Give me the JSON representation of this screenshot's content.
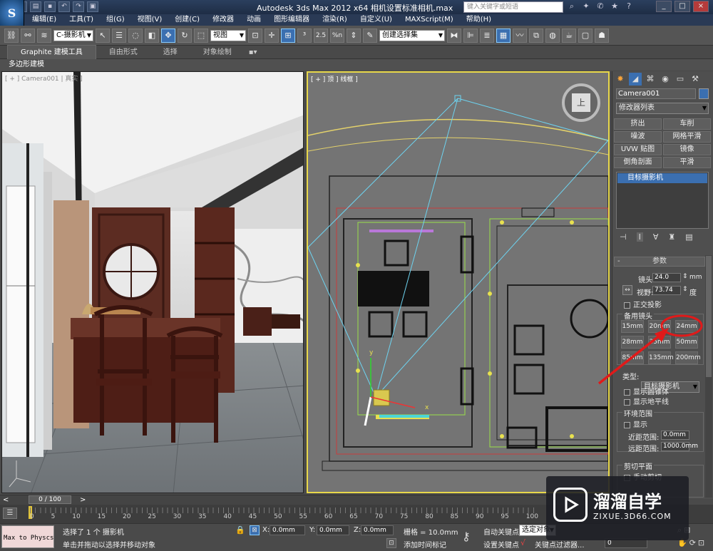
{
  "titlebar": {
    "title": "Autodesk 3ds Max  2012 x64     相机设置标准相机.max",
    "search_placeholder": "键入关键字或短语",
    "controls": [
      "_",
      "□",
      "×"
    ]
  },
  "menu": [
    "编辑(E)",
    "工具(T)",
    "组(G)",
    "视图(V)",
    "创建(C)",
    "修改器",
    "动画",
    "图形编辑器",
    "渲染(R)",
    "自定义(U)",
    "MAXScript(M)",
    "帮助(H)"
  ],
  "toolbar": {
    "filter": "C-摄影机",
    "ref_coord": "视图",
    "selection_set": "创建选择集",
    "angle_snap": "2.5",
    "percent_snap": "%n"
  },
  "ribbon": {
    "tabs": [
      "Graphite 建模工具",
      "自由形式",
      "选择",
      "对象绘制"
    ],
    "sub_label": "多边形建模"
  },
  "viewports": {
    "left_label": "[ + ] Camera001 | 真实 ]",
    "right_label": "[ + ] 顶 ] 线框 ]",
    "viewcube_label": "上"
  },
  "command_panel": {
    "object_name": "Camera001",
    "modifier_list": "修改器列表",
    "modifier_buttons": [
      "挤出",
      "车削",
      "噪波",
      "网格平滑",
      "UVW 贴图",
      "镜像",
      "倒角剖面",
      "平滑"
    ],
    "stack_item": "目标摄影机",
    "rollout_title": "参数",
    "lens_label": "镜头:",
    "lens_value": "24.0",
    "lens_unit": "mm",
    "fov_label": "视野:",
    "fov_value": "73.74",
    "fov_unit": "度",
    "ortho_label": "正交投影",
    "stock_lenses_label": "备用镜头",
    "stock_lenses": [
      "15mm",
      "20mm",
      "24mm",
      "28mm",
      "35mm",
      "50mm",
      "85mm",
      "135mm",
      "200mm"
    ],
    "type_label": "类型:",
    "type_value": "目标摄影机",
    "show_cone": "显示圆锥体",
    "show_horizon": "显示地平线",
    "env_range_label": "环境范围",
    "env_show": "显示",
    "near_range_label": "近距范围:",
    "near_range_value": "0.0mm",
    "far_range_label": "远距范围:",
    "far_range_value": "1000.0mm",
    "clip_label": "剪切平面",
    "manual_clip": "手动剪切"
  },
  "timeline": {
    "frame_display": "0 / 100",
    "ticks": [
      "0",
      "5",
      "10",
      "15",
      "20",
      "25",
      "30",
      "35",
      "40",
      "45",
      "50",
      "55",
      "60",
      "65",
      "70",
      "75",
      "80",
      "85",
      "90",
      "95",
      "100"
    ]
  },
  "statusbar": {
    "script_field": "Max to Physcs",
    "status_line1": "选择了 1 个 摄影机",
    "status_line2": "单击并拖动以选择并移动对象",
    "x_label": "X:",
    "x_value": "0.0mm",
    "y_label": "Y:",
    "y_value": "0.0mm",
    "z_label": "Z:",
    "z_value": "0.0mm",
    "grid": "栅格 = 10.0mm",
    "add_time_tag": "添加时间标记",
    "auto_key": "自动关键点",
    "auto_key_dropdown": "选定对象",
    "set_key": "设置关键点",
    "key_filters": "关键点过滤器...",
    "frame_value": "0"
  },
  "watermark": {
    "brand": "溜溜自学",
    "url": "ZIXUE.3D66.COM"
  }
}
